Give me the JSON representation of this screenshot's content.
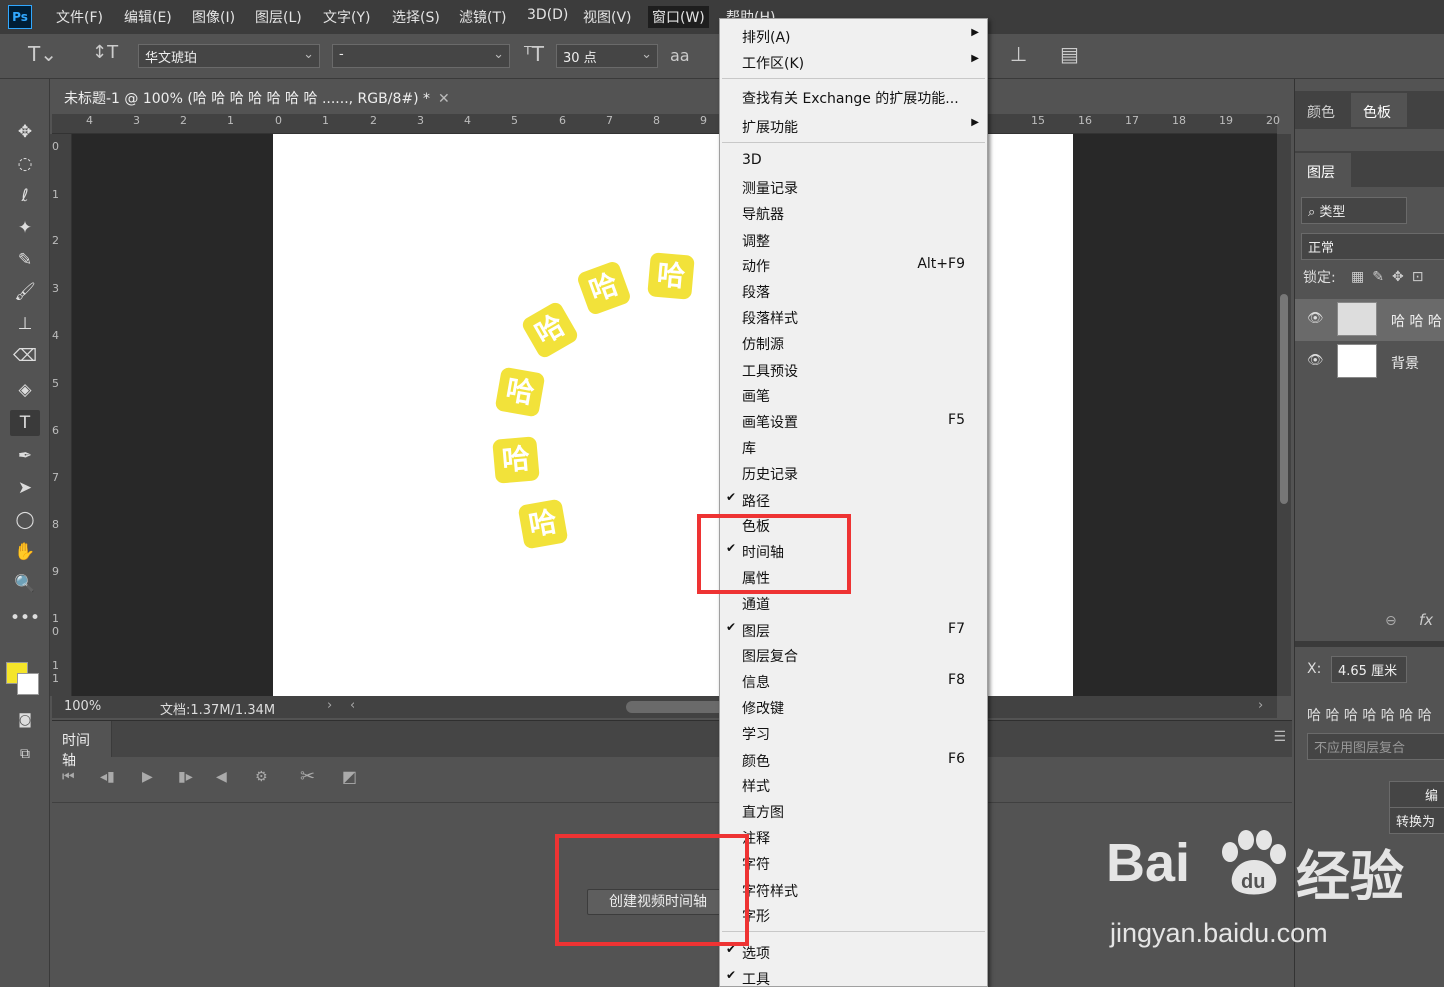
{
  "app": {
    "logo": "Ps"
  },
  "menu": [
    "文件(F)",
    "编辑(E)",
    "图像(I)",
    "图层(L)",
    "文字(Y)",
    "选择(S)",
    "滤镜(T)",
    "3D(D)",
    "视图(V)",
    "窗口(W)",
    "帮助(H)"
  ],
  "options": {
    "font_family": "华文琥珀",
    "font_style": "-",
    "font_size": "30 点",
    "antialias": "aa"
  },
  "document": {
    "tab_title": "未标题-1 @ 100% (哈 哈 哈 哈 哈 哈 哈 ......, RGB/8#) *",
    "zoom": "100%",
    "doc_size": "文档:1.37M/1.34M",
    "canvas_char": "哈",
    "text_color": "#f2e23a"
  },
  "rulers": {
    "h": [
      "4",
      "3",
      "2",
      "1",
      "0",
      "1",
      "2",
      "3",
      "4",
      "5",
      "6",
      "7",
      "8",
      "9",
      "15",
      "16",
      "17",
      "18",
      "19",
      "20",
      "2"
    ],
    "v": [
      "0",
      "1",
      "2",
      "3",
      "4",
      "5",
      "6",
      "7",
      "8",
      "9",
      "1 0",
      "1 1"
    ]
  },
  "colors": {
    "foreground": "#f5e52a",
    "background": "#ffffff",
    "highlight": "#ee3333"
  },
  "timeline": {
    "tab": "时间轴",
    "create_button": "创建视频时间轴"
  },
  "right_panel": {
    "color_tabs": [
      "颜色",
      "色板"
    ],
    "layers_tab": "图层",
    "filter": "类型",
    "blend_mode": "正常",
    "lock_label": "锁定:",
    "layers": [
      {
        "name": "哈 哈 哈",
        "visible": true,
        "type": "text"
      },
      {
        "name": "背景",
        "visible": true,
        "type": "background"
      }
    ],
    "x_label": "X:",
    "x_value": "4.65 厘米",
    "props_text": "哈 哈 哈 哈 哈 哈 哈",
    "comp_placeholder": "不应用图层复合",
    "btn_edit": "编",
    "btn_convert": "转换为"
  },
  "window_menu": [
    {
      "label": "排列(A)",
      "submenu": true
    },
    {
      "label": "工作区(K)",
      "submenu": true
    },
    {
      "separator": true
    },
    {
      "label": "查找有关 Exchange 的扩展功能..."
    },
    {
      "label": "扩展功能",
      "submenu": true
    },
    {
      "separator": true
    },
    {
      "label": "3D"
    },
    {
      "label": "测量记录"
    },
    {
      "label": "导航器"
    },
    {
      "label": "调整"
    },
    {
      "label": "动作",
      "shortcut": "Alt+F9"
    },
    {
      "label": "段落"
    },
    {
      "label": "段落样式"
    },
    {
      "label": "仿制源"
    },
    {
      "label": "工具预设"
    },
    {
      "label": "画笔"
    },
    {
      "label": "画笔设置",
      "shortcut": "F5"
    },
    {
      "label": "库"
    },
    {
      "label": "历史记录"
    },
    {
      "label": "路径",
      "checked": true
    },
    {
      "label": "色板"
    },
    {
      "label": "时间轴",
      "checked": true
    },
    {
      "label": "属性"
    },
    {
      "label": "通道"
    },
    {
      "label": "图层",
      "shortcut": "F7",
      "checked": true
    },
    {
      "label": "图层复合"
    },
    {
      "label": "信息",
      "shortcut": "F8"
    },
    {
      "label": "修改键"
    },
    {
      "label": "学习"
    },
    {
      "label": "颜色",
      "shortcut": "F6"
    },
    {
      "label": "样式"
    },
    {
      "label": "直方图"
    },
    {
      "label": "注释"
    },
    {
      "label": "字符"
    },
    {
      "label": "字符样式"
    },
    {
      "label": "字形"
    },
    {
      "separator": true
    },
    {
      "label": "选项",
      "checked": true
    },
    {
      "label": "工具",
      "checked": true
    }
  ],
  "watermark": {
    "logo": "Bai",
    "logo_suffix": "经验",
    "url": "jingyan.baidu.com"
  }
}
